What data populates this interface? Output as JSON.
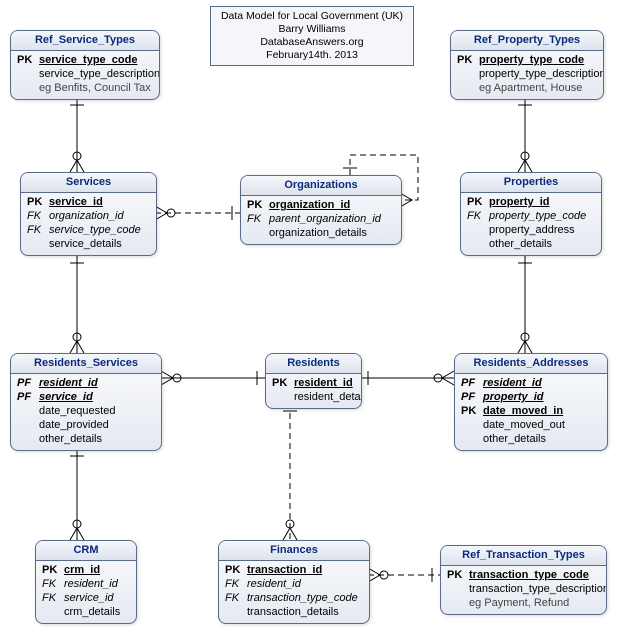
{
  "info": {
    "line1": "Data Model for Local Government (UK)",
    "line2": "Barry Williams",
    "line3": "DatabaseAnswers.org",
    "line4": "February14th. 2013"
  },
  "entities": {
    "ref_service_types": {
      "title": "Ref_Service_Types",
      "rows": [
        {
          "key": "PK",
          "name": "service_type_code",
          "pk": true
        },
        {
          "key": "",
          "name": "service_type_description"
        },
        {
          "key": "",
          "name": "eg Benfits, Council Tax",
          "eg": true
        }
      ]
    },
    "ref_property_types": {
      "title": "Ref_Property_Types",
      "rows": [
        {
          "key": "PK",
          "name": "property_type_code",
          "pk": true
        },
        {
          "key": "",
          "name": "property_type_description"
        },
        {
          "key": "",
          "name": "eg Apartment, House",
          "eg": true
        }
      ]
    },
    "services": {
      "title": "Services",
      "rows": [
        {
          "key": "PK",
          "name": "service_id",
          "pk": true
        },
        {
          "key": "FK",
          "name": "organization_id",
          "fk": true
        },
        {
          "key": "FK",
          "name": "service_type_code",
          "fk": true
        },
        {
          "key": "",
          "name": "service_details"
        }
      ]
    },
    "organizations": {
      "title": "Organizations",
      "rows": [
        {
          "key": "PK",
          "name": "organization_id",
          "pk": true
        },
        {
          "key": "FK",
          "name": "parent_organization_id",
          "fk": true
        },
        {
          "key": "",
          "name": "organization_details"
        }
      ]
    },
    "properties": {
      "title": "Properties",
      "rows": [
        {
          "key": "PK",
          "name": "property_id",
          "pk": true
        },
        {
          "key": "FK",
          "name": "property_type_code",
          "fk": true
        },
        {
          "key": "",
          "name": "property_address"
        },
        {
          "key": "",
          "name": "other_details"
        }
      ]
    },
    "residents_services": {
      "title": "Residents_Services",
      "rows": [
        {
          "key": "PF",
          "name": "resident_id",
          "pk": true,
          "fk": true
        },
        {
          "key": "PF",
          "name": "service_id",
          "pk": true,
          "fk": true
        },
        {
          "key": "",
          "name": "date_requested"
        },
        {
          "key": "",
          "name": "date_provided"
        },
        {
          "key": "",
          "name": "other_details"
        }
      ]
    },
    "residents": {
      "title": "Residents",
      "rows": [
        {
          "key": "PK",
          "name": "resident_id",
          "pk": true
        },
        {
          "key": "",
          "name": "resident_details"
        }
      ]
    },
    "residents_addresses": {
      "title": "Residents_Addresses",
      "rows": [
        {
          "key": "PF",
          "name": "resident_id",
          "pk": true,
          "fk": true
        },
        {
          "key": "PF",
          "name": "property_id",
          "pk": true,
          "fk": true
        },
        {
          "key": "PK",
          "name": "date_moved_in",
          "pk": true
        },
        {
          "key": "",
          "name": "date_moved_out"
        },
        {
          "key": "",
          "name": "other_details"
        }
      ]
    },
    "crm": {
      "title": "CRM",
      "rows": [
        {
          "key": "PK",
          "name": "crm_id",
          "pk": true
        },
        {
          "key": "FK",
          "name": "resident_id",
          "fk": true
        },
        {
          "key": "FK",
          "name": "service_id",
          "fk": true
        },
        {
          "key": "",
          "name": "crm_details"
        }
      ]
    },
    "finances": {
      "title": "Finances",
      "rows": [
        {
          "key": "PK",
          "name": "transaction_id",
          "pk": true
        },
        {
          "key": "FK",
          "name": "resident_id",
          "fk": true
        },
        {
          "key": "FK",
          "name": "transaction_type_code",
          "fk": true
        },
        {
          "key": "",
          "name": "transaction_details"
        }
      ]
    },
    "ref_transaction_types": {
      "title": "Ref_Transaction_Types",
      "rows": [
        {
          "key": "PK",
          "name": "transaction_type_code",
          "pk": true
        },
        {
          "key": "",
          "name": "transaction_type_description"
        },
        {
          "key": "",
          "name": "eg Payment, Refund",
          "eg": true
        }
      ]
    }
  }
}
